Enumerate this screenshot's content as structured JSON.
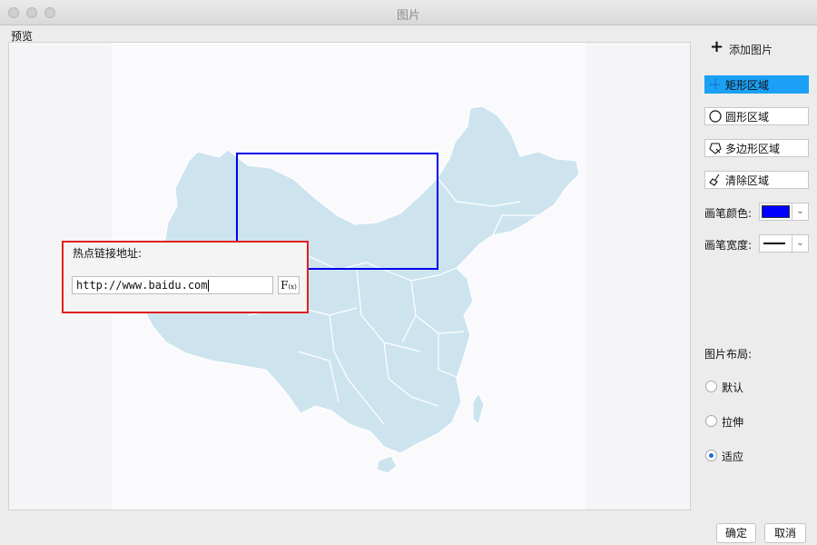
{
  "window": {
    "title": "图片"
  },
  "preview": {
    "label": "预览"
  },
  "hotspot": {
    "label": "热点链接地址:",
    "url": "http://www.baidu.com",
    "fx_label": "F",
    "fx_sub": "(x)"
  },
  "sidebar": {
    "add_image": "添加图片",
    "tools": [
      {
        "label": "矩形区域",
        "active": true,
        "icon": "rectangle-select-icon"
      },
      {
        "label": "圆形区域",
        "active": false,
        "icon": "circle-select-icon"
      },
      {
        "label": "多边形区域",
        "active": false,
        "icon": "polygon-select-icon"
      },
      {
        "label": "清除区域",
        "active": false,
        "icon": "broom-icon"
      }
    ],
    "pen_color_label": "画笔颜色:",
    "pen_color": "#0000ff",
    "pen_width_label": "画笔宽度:",
    "layout_label": "图片布局:",
    "layout_options": [
      {
        "label": "默认",
        "selected": false
      },
      {
        "label": "拉伸",
        "selected": false
      },
      {
        "label": "适应",
        "selected": true
      }
    ]
  },
  "footer": {
    "ok": "确定",
    "cancel": "取消"
  },
  "colors": {
    "map_fill": "#cde4ef",
    "map_border": "#ffffff",
    "selection": "#0000ee",
    "active_tool": "#1aa0f5",
    "hotspot_border": "#e02020"
  }
}
